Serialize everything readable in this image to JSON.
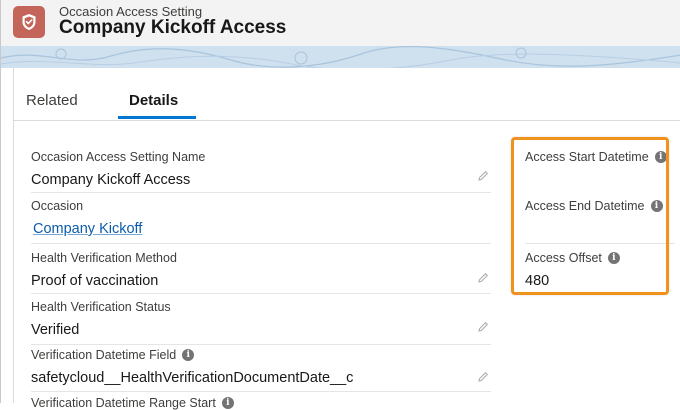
{
  "header": {
    "object_label": "Occasion Access Setting",
    "record_title": "Company Kickoff Access"
  },
  "tabs": [
    {
      "label": "Related",
      "active": false
    },
    {
      "label": "Details",
      "active": true
    }
  ],
  "left_fields": [
    {
      "label": "Occasion Access Setting Name",
      "value": "Company Kickoff Access",
      "editable": true,
      "link": false,
      "info": false
    },
    {
      "label": "Occasion",
      "value": "Company Kickoff",
      "editable": false,
      "link": true,
      "info": false
    },
    {
      "label": "Health Verification Method",
      "value": "Proof of vaccination",
      "editable": true,
      "link": false,
      "info": false
    },
    {
      "label": "Health Verification Status",
      "value": "Verified",
      "editable": true,
      "link": false,
      "info": false
    },
    {
      "label": "Verification Datetime Field",
      "value": "safetycloud__HealthVerificationDocumentDate__c",
      "editable": true,
      "link": false,
      "info": true
    },
    {
      "label": "Verification Datetime Range Start",
      "value": "",
      "editable": false,
      "link": false,
      "info": true
    }
  ],
  "right_fields": [
    {
      "label": "Access Start Datetime",
      "value": "",
      "info": true
    },
    {
      "label": "Access End Datetime",
      "value": "",
      "info": true
    },
    {
      "label": "Access Offset",
      "value": "480",
      "info": true
    }
  ],
  "icons": {
    "app": "shield-icon",
    "edit": "pencil-icon",
    "info": "info-icon"
  },
  "colors": {
    "app_icon_bg": "#c4655a",
    "active_tab_underline": "#0176d3",
    "link": "#0b5cab",
    "highlight_border": "#f0931c"
  }
}
